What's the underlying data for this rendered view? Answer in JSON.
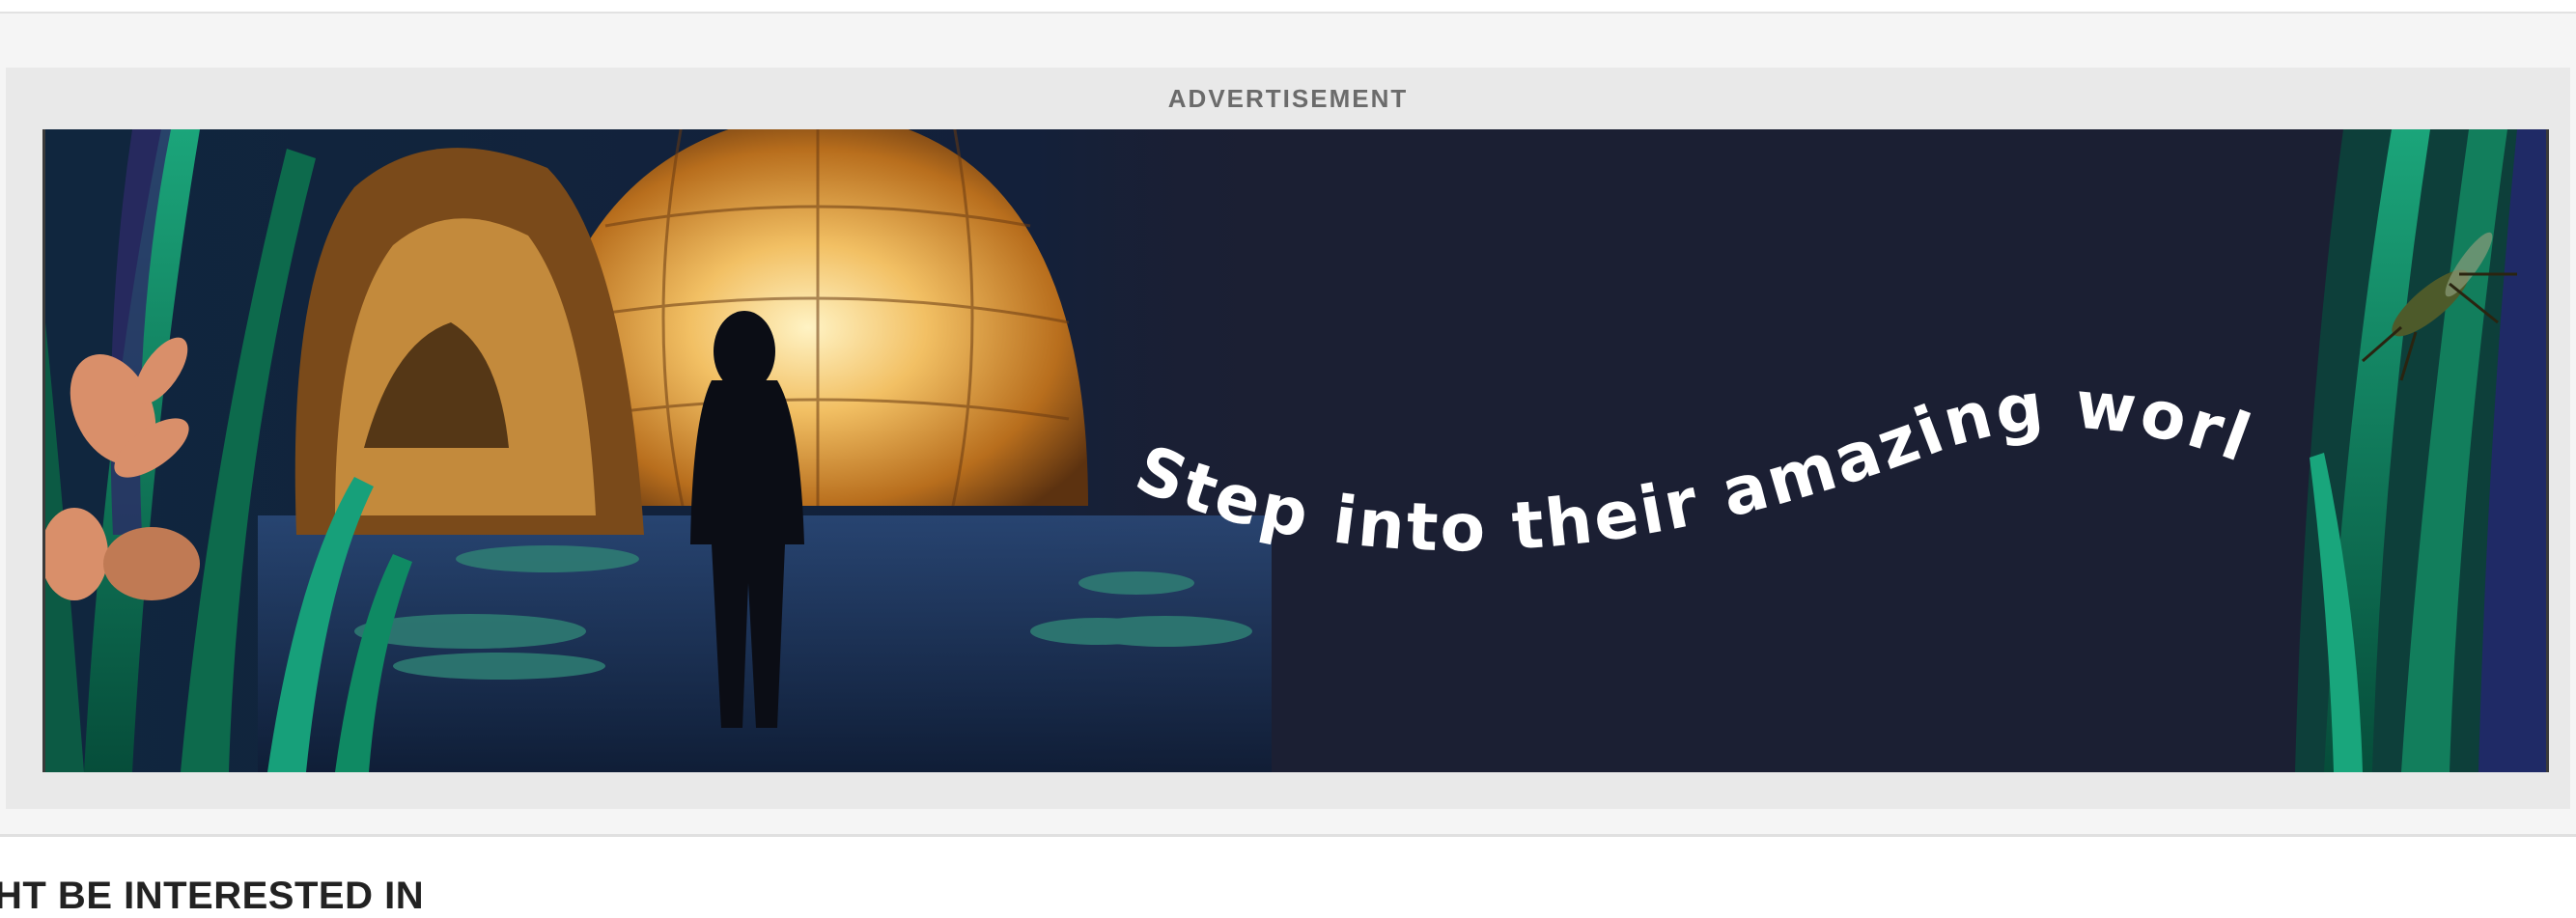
{
  "ad": {
    "label": "ADVERTISEMENT",
    "tagline": "Step into their amazing world",
    "colors": {
      "background": "#1b1f33",
      "foliage": "#0f7d5a",
      "dome": "#e3a64a",
      "text": "#ffffff"
    }
  },
  "section": {
    "heading": "HT BE INTERESTED IN"
  }
}
